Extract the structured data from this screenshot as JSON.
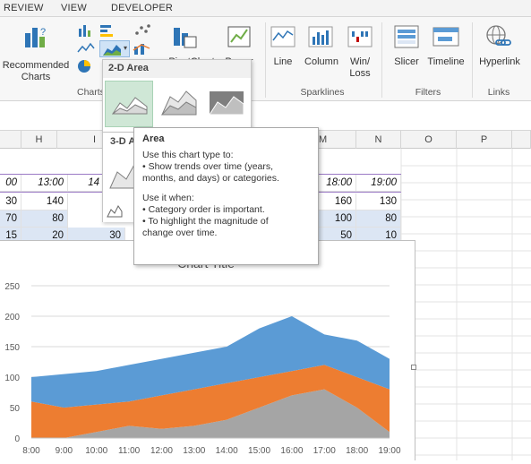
{
  "ribbon_tabs": [
    "REVIEW",
    "VIEW",
    "DEVELOPER"
  ],
  "ribbon": {
    "recommended_charts": [
      "Recommended",
      "Charts"
    ],
    "charts_group": "Charts",
    "pivotchart": "PivotChart",
    "power": "Power",
    "sparklines": {
      "line": "Line",
      "column": "Column",
      "winloss": [
        "Win/",
        "Loss"
      ],
      "group": "Sparklines"
    },
    "filters": {
      "slicer": "Slicer",
      "timeline": "Timeline",
      "group": "Filters"
    },
    "links": {
      "hyperlink": "Hyperlink",
      "group": "Links"
    }
  },
  "dropdown": {
    "section_2d": "2-D Area",
    "section_3d": "3-D Area"
  },
  "tooltip": {
    "title": "Area",
    "line1": "Use this chart type to:",
    "line2": "• Show trends over time (years,",
    "line3": "months, and days) or categories.",
    "line4": "Use it when:",
    "line5": "• Category order is important.",
    "line6": "• To highlight the magnitude of",
    "line7": "change over time."
  },
  "columns": [
    "H",
    "I",
    "M",
    "N",
    "O",
    "P"
  ],
  "grid": {
    "row_header": [
      "00",
      "13:00",
      "14",
      "18:00",
      "19:00"
    ],
    "row1": [
      "30",
      "140",
      "160",
      "130"
    ],
    "row2": [
      "70",
      "80",
      "100",
      "80"
    ],
    "row3": [
      "15",
      "20",
      "30",
      "50",
      "10"
    ]
  },
  "chart_data": {
    "type": "area",
    "title": "Chart Title",
    "stacked": true,
    "categories": [
      "8:00",
      "9:00",
      "10:00",
      "11:00",
      "12:00",
      "13:00",
      "14:00",
      "15:00",
      "16:00",
      "17:00",
      "18:00",
      "19:00"
    ],
    "series": [
      {
        "color": "#a5a5a5",
        "values": [
          0,
          0,
          10,
          20,
          15,
          20,
          30,
          50,
          70,
          80,
          50,
          10
        ]
      },
      {
        "color": "#ed7d31",
        "values": [
          60,
          50,
          45,
          40,
          55,
          60,
          60,
          50,
          40,
          40,
          50,
          70
        ]
      },
      {
        "color": "#5b9bd5",
        "values": [
          40,
          55,
          55,
          60,
          60,
          60,
          60,
          80,
          90,
          50,
          60,
          50
        ]
      }
    ],
    "ylim": [
      0,
      250
    ],
    "yticks": [
      0,
      50,
      100,
      150,
      200,
      250
    ],
    "grid": true
  }
}
